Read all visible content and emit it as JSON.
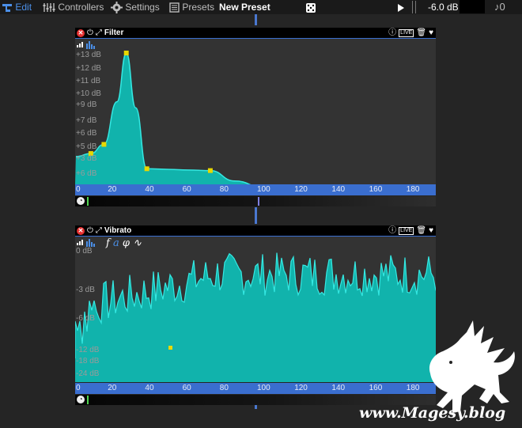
{
  "toolbar": {
    "edit_label": "Edit",
    "controllers_label": "Controllers",
    "settings_label": "Settings",
    "presets_label": "Presets",
    "preset_name": "New Preset",
    "volume": "-6.0 dB",
    "note_count": "0"
  },
  "filter_panel": {
    "title": "Filter",
    "live_badge": "LIVE",
    "db_labels": [
      "+13 dB",
      "+12 dB",
      "+11 dB",
      "+10 dB",
      "+9 dB",
      "+7 dB",
      "+6 dB",
      "+5 dB",
      "+3 dB",
      "+6 dB"
    ],
    "x_ticks": [
      "0",
      "20",
      "40",
      "60",
      "80",
      "100",
      "120",
      "140",
      "160",
      "180"
    ],
    "curve_points": [
      [
        0,
        -4
      ],
      [
        8,
        -3.5
      ],
      [
        15,
        -2
      ],
      [
        22,
        5
      ],
      [
        27,
        13
      ],
      [
        32,
        4
      ],
      [
        38,
        -6
      ],
      [
        50,
        -6.1
      ],
      [
        60,
        -6.2
      ],
      [
        72,
        -6.3
      ],
      [
        85,
        -8
      ],
      [
        100,
        -9
      ],
      [
        140,
        -9.6
      ],
      [
        193,
        -10
      ]
    ],
    "timeline_marker_x": 100
  },
  "vibrato_panel": {
    "title": "Vibrato",
    "live_badge": "LIVE",
    "mod_icons": [
      "f",
      "a",
      "φ",
      "∿"
    ],
    "db_labels": [
      "0 dB",
      "-3 dB",
      "-6 dB",
      "-12 dB",
      "-18 dB",
      "-24 dB"
    ],
    "x_ticks": [
      "0",
      "20",
      "40",
      "60",
      "80",
      "100",
      "120",
      "140",
      "160",
      "180"
    ],
    "waveform": "random-vibrato"
  },
  "watermark": {
    "text": "www.Magesy.blog"
  },
  "colors": {
    "accent": "#3a6ecf",
    "fill": "#11b3ac",
    "stroke": "#34e8e2",
    "close": "#e53030"
  }
}
